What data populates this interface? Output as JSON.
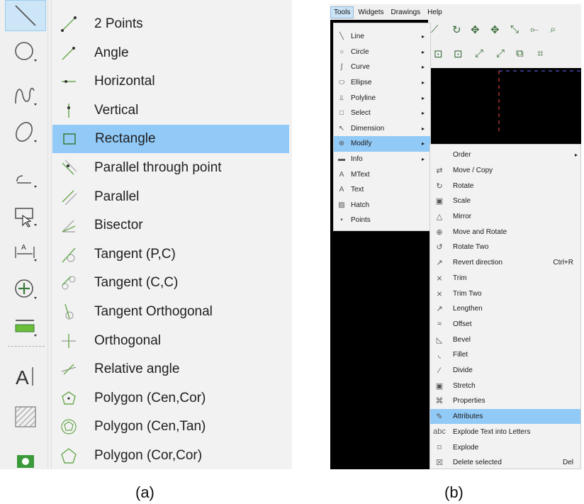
{
  "panel_a": {
    "caption": "(a)",
    "menu_items": [
      {
        "label": "2 Points",
        "icon": "two-points-line-icon"
      },
      {
        "label": "Angle",
        "icon": "angle-line-icon"
      },
      {
        "label": "Horizontal",
        "icon": "horizontal-line-icon"
      },
      {
        "label": "Vertical",
        "icon": "vertical-line-icon"
      },
      {
        "label": "Rectangle",
        "icon": "rectangle-icon"
      },
      {
        "label": "Parallel through point",
        "icon": "parallel-through-point-icon"
      },
      {
        "label": "Parallel",
        "icon": "parallel-icon"
      },
      {
        "label": "Bisector",
        "icon": "bisector-icon"
      },
      {
        "label": "Tangent (P,C)",
        "icon": "tangent-pc-icon"
      },
      {
        "label": "Tangent (C,C)",
        "icon": "tangent-cc-icon"
      },
      {
        "label": "Tangent Orthogonal",
        "icon": "tangent-orthogonal-icon"
      },
      {
        "label": "Orthogonal",
        "icon": "orthogonal-icon"
      },
      {
        "label": "Relative angle",
        "icon": "relative-angle-icon"
      },
      {
        "label": "Polygon (Cen,Cor)",
        "icon": "polygon-cen-cor-icon"
      },
      {
        "label": "Polygon (Cen,Tan)",
        "icon": "polygon-cen-tan-icon"
      },
      {
        "label": "Polygon (Cor,Cor)",
        "icon": "polygon-cor-cor-icon"
      }
    ],
    "highlighted": "Rectangle",
    "toolbar": [
      "line-tool-icon",
      "circle-tool-icon",
      "curve-tool-icon",
      "ellipse-tool-icon",
      "polyline-tool-icon",
      "select-tool-icon",
      "dimension-tool-icon",
      "modify-tool-icon",
      "info-tool-icon",
      "text-tool-icon",
      "hatch-tool-icon",
      "camera-icon"
    ]
  },
  "panel_b": {
    "caption": "(b)",
    "menubar": [
      "Tools",
      "Widgets",
      "Drawings",
      "Help"
    ],
    "active_menu": "Tools",
    "tools_menu": [
      {
        "label": "Line",
        "icon": "╲",
        "submenu": true
      },
      {
        "label": "Circle",
        "icon": "○",
        "submenu": true
      },
      {
        "label": "Curve",
        "icon": "∫",
        "submenu": true
      },
      {
        "label": "Ellipse",
        "icon": "⬭",
        "submenu": true
      },
      {
        "label": "Polyline",
        "icon": "⫫",
        "submenu": true
      },
      {
        "label": "Select",
        "icon": "□",
        "submenu": true
      },
      {
        "label": "Dimension",
        "icon": "↖",
        "submenu": true
      },
      {
        "label": "Modify",
        "icon": "⊕",
        "submenu": true
      },
      {
        "label": "Info",
        "icon": "▬",
        "submenu": true
      },
      {
        "label": "MText",
        "icon": "A",
        "submenu": false
      },
      {
        "label": "Text",
        "icon": "A",
        "submenu": false
      },
      {
        "label": "Hatch",
        "icon": "▨",
        "submenu": false
      },
      {
        "label": "Points",
        "icon": "•",
        "submenu": false
      }
    ],
    "modify_menu": [
      {
        "label": "Order",
        "icon": "",
        "shortcut": "",
        "submenu": true
      },
      {
        "label": "Move / Copy",
        "icon": "⇄",
        "shortcut": ""
      },
      {
        "label": "Rotate",
        "icon": "↻",
        "shortcut": ""
      },
      {
        "label": "Scale",
        "icon": "▣",
        "shortcut": ""
      },
      {
        "label": "Mirror",
        "icon": "△",
        "shortcut": ""
      },
      {
        "label": "Move and Rotate",
        "icon": "⊕",
        "shortcut": ""
      },
      {
        "label": "Rotate Two",
        "icon": "↺",
        "shortcut": ""
      },
      {
        "label": "Revert direction",
        "icon": "↗",
        "shortcut": "Ctrl+R"
      },
      {
        "label": "Trim",
        "icon": "⨯",
        "shortcut": ""
      },
      {
        "label": "Trim Two",
        "icon": "⨯",
        "shortcut": ""
      },
      {
        "label": "Lengthen",
        "icon": "↗",
        "shortcut": ""
      },
      {
        "label": "Offset",
        "icon": "≈",
        "shortcut": ""
      },
      {
        "label": "Bevel",
        "icon": "◺",
        "shortcut": ""
      },
      {
        "label": "Fillet",
        "icon": "◟",
        "shortcut": ""
      },
      {
        "label": "Divide",
        "icon": "∕",
        "shortcut": ""
      },
      {
        "label": "Stretch",
        "icon": "▣",
        "shortcut": ""
      },
      {
        "label": "Properties",
        "icon": "⌘",
        "shortcut": ""
      },
      {
        "label": "Attributes",
        "icon": "✎",
        "shortcut": ""
      },
      {
        "label": "Explode Text into Letters",
        "icon": "abc",
        "shortcut": ""
      },
      {
        "label": "Explode",
        "icon": "⌑",
        "shortcut": ""
      },
      {
        "label": "Delete selected",
        "icon": "☒",
        "shortcut": "Del"
      }
    ],
    "highlighted_tools": "Modify",
    "highlighted_modify": "Attributes",
    "submenu_arrow": "▸"
  }
}
